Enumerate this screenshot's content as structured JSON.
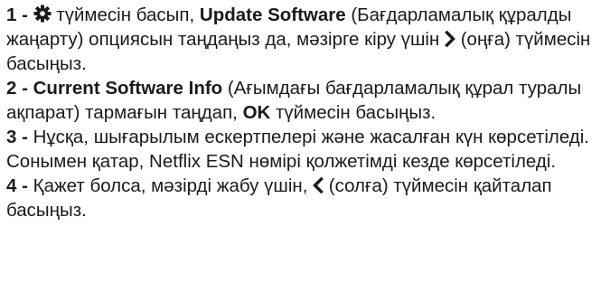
{
  "steps": [
    {
      "num": "1 - ",
      "gear_icon": "gear-icon",
      "t1": " түймесін басып, ",
      "b1": "Update Software",
      "t2": " (Бағдарламалық құралды жаңарту) опциясын таңдаңыз да, мәзірге кіру үшін ",
      "arrow_icon": "chevron-right-icon",
      "t3": " (оңға) түймесін басыңыз."
    },
    {
      "num": "2 - ",
      "b1": "Current Software Info",
      "t1": " (Ағымдағы бағдарламалық құрал туралы ақпарат) тармағын таңдап, ",
      "b2": "OK",
      "t2": " түймесін басыңыз."
    },
    {
      "num": "3 - ",
      "t1": "Нұсқа, шығарылым ескертпелері және жасалған күн көрсетіледі. Сонымен қатар, Netflix ESN нөмірі қолжетімді кезде көрсетіледі."
    },
    {
      "num": "4 - ",
      "t1": "Қажет болса, мәзірді жабу үшін, ",
      "arrow_icon": "chevron-left-icon",
      "t2": " (солға) түймесін қайталап басыңыз."
    }
  ]
}
